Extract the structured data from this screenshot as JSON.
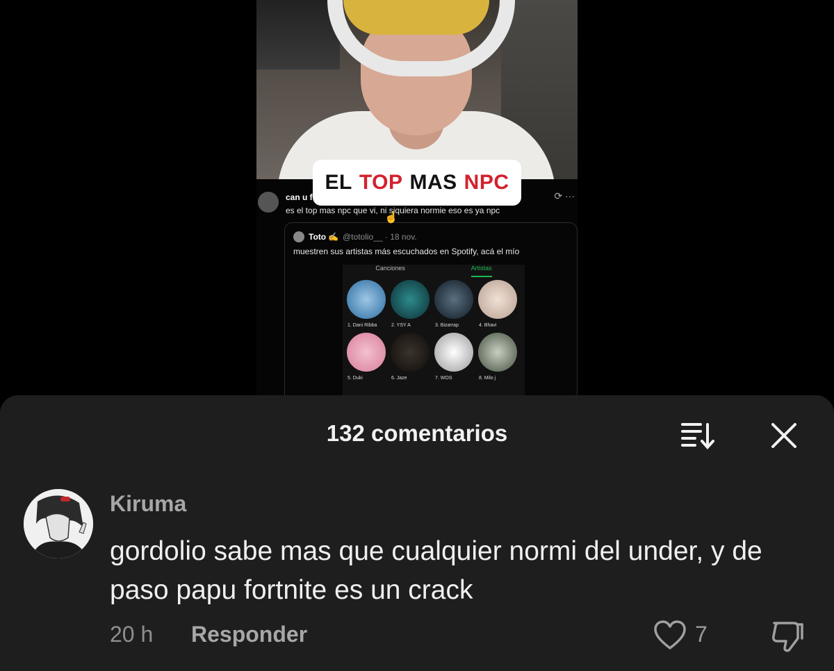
{
  "video": {
    "overlay_left": "EL",
    "overlay_red1": "TOP",
    "overlay_mid": "MAS",
    "overlay_red2": "NPC",
    "tweet": {
      "name": "can u f",
      "text": "es el top mas npc que vi, ni siquiera normie eso es ya npc",
      "quote_name": "Toto ✍️",
      "quote_meta": "@totolio__ · 18 nov.",
      "quote_text": "muestren sus artistas más escuchados en Spotify, acá el mío",
      "tabs": [
        "Canciones",
        "Artistas"
      ],
      "artists": [
        "1. Dani Ribba",
        "2. YSY A",
        "3. Bizarrap",
        "4. Bhavi",
        "5. Duki",
        "6. Jaze",
        "7. WOS",
        "8. Milo j"
      ]
    }
  },
  "comments": {
    "title": "132 comentarios",
    "items": [
      {
        "user": "Kiruma",
        "text": "gordolio sabe mas que cualquier normi del under, y de paso papu fortnite es un crack",
        "time": "20 h",
        "reply_label": "Responder",
        "likes": "7"
      }
    ]
  },
  "colors": {
    "sheet_bg": "#1e1e1e",
    "accent_red": "#d2212d",
    "spotify_green": "#1db954"
  },
  "icons": [
    "sort-icon",
    "close-icon",
    "heart-icon",
    "dislike-icon"
  ]
}
